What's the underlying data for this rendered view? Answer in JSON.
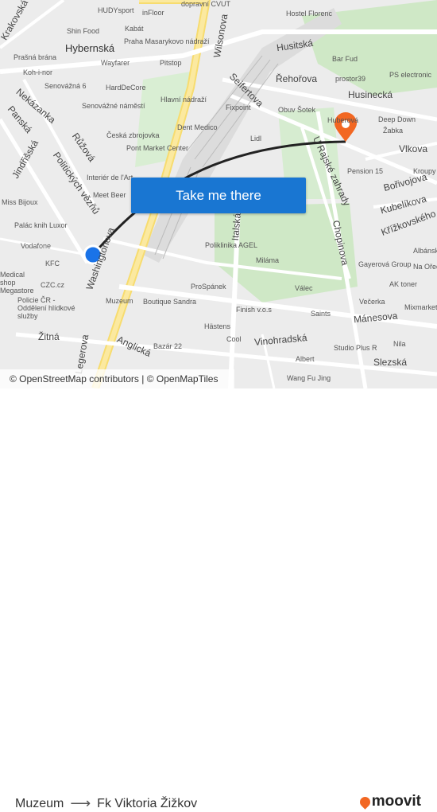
{
  "map": {
    "labels": [
      "Hybernská",
      "Wilsonova",
      "Husitská",
      "Řehořova",
      "Husinecká",
      "Seifertova",
      "Vlkova",
      "Bořivojova",
      "Kubelíkova",
      "Křížkovského",
      "Chopinova",
      "U Rajské zahrady",
      "Italská",
      "Mánesova",
      "Vinohradská",
      "Slezská",
      "Žitná",
      "Anglická",
      "Politických vězňů",
      "Jindřišská",
      "Panská",
      "Nekázanka",
      "Růžová",
      "Washingtonova",
      "Legerova",
      "Krakovská",
      "Senovážné náměstí",
      "Shin Food",
      "Kabát",
      "Praha Masarykovo nádraží",
      "Wayfarer",
      "Pitstop",
      "Hlavní nádraží",
      "Dent Medico",
      "Pont Market Center",
      "Fixpoint",
      "Lidl",
      "Obuv Šotek",
      "Hostel Florenc",
      "Bar Fud",
      "prostor39",
      "PS electronic",
      "Deep Down",
      "Žabka",
      "Pension 15",
      "Poliklinika AGEL",
      "Miláma",
      "Válec",
      "Gayerová Group",
      "AK toner",
      "ProSpánek",
      "Finish v.o.s",
      "Saints",
      "Večerka",
      "Mixmarket",
      "Muzeum",
      "Boutique Sandra",
      "Hästens",
      "Cool",
      "Bazár 22",
      "Studio Plus R",
      "Nila",
      "Albert",
      "Wang Fu Jing",
      "Palác knih Luxor",
      "Vodafone",
      "KFC",
      "CZC.cz",
      "Miss Bijoux",
      "Meet Beer",
      "Česká zbrojovka",
      "HardDeCore",
      "Senovážná 6",
      "Prašná brána",
      "Koh-i-nor",
      "dopravní CVUT",
      "HUDYsport",
      "inFloor",
      "Interiér de l'Art",
      "Policie ČR - Oddělení hlídkové služby",
      "Medical shop Megastore",
      "Huberová",
      "Kroupy",
      "Albánská",
      "Na Ořechu"
    ],
    "attribution": "© OpenStreetMap contributors | © OpenMapTiles",
    "route_color": "#222222",
    "origin_color": "#1a73e8",
    "destination_color": "#f26722"
  },
  "cta": {
    "label": "Take me there",
    "color": "#1976d2"
  },
  "footer": {
    "origin": "Muzeum",
    "destination": "Fk Viktoria Žižkov",
    "arrow_icon": "arrow-right-icon",
    "brand": "moovit",
    "brand_color": "#f26722"
  }
}
